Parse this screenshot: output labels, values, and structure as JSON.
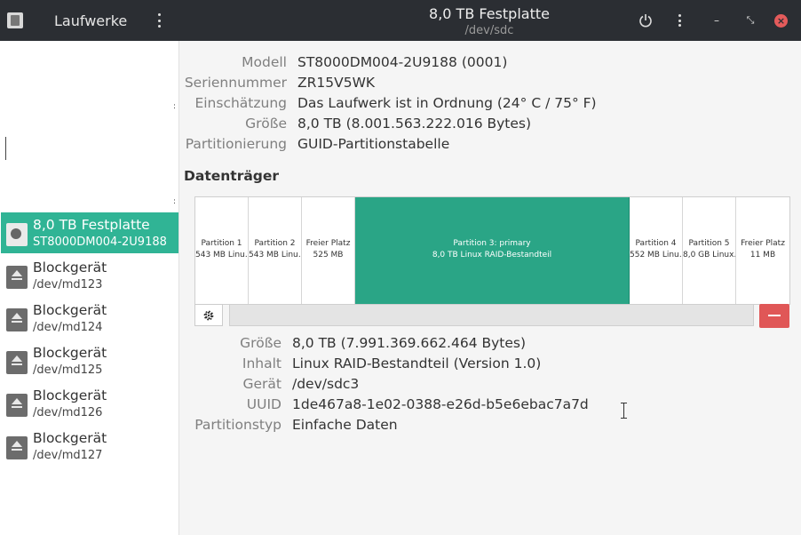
{
  "header": {
    "left_title": "Laufwerke",
    "title": "8,0 TB Festplatte",
    "subtitle": "/dev/sdc",
    "minimize_glyph": "–",
    "restore_glyph": "⤡",
    "close_glyph": "×",
    "icons": [
      "disks-app-icon",
      "menu-dots-icon",
      "power-icon",
      "menu-dots-icon",
      "minimize-icon",
      "restore-icon",
      "close-icon"
    ]
  },
  "sidebar": {
    "items": [
      {
        "title": "8,0 TB Festplatte",
        "subtitle": "ST8000DM004-2U9188",
        "selected": true
      },
      {
        "title": "Blockgerät",
        "subtitle": "/dev/md123"
      },
      {
        "title": "Blockgerät",
        "subtitle": "/dev/md124"
      },
      {
        "title": "Blockgerät",
        "subtitle": "/dev/md125"
      },
      {
        "title": "Blockgerät",
        "subtitle": "/dev/md126"
      },
      {
        "title": "Blockgerät",
        "subtitle": "/dev/md127"
      }
    ]
  },
  "drive": {
    "model_label": "Modell",
    "model": "ST8000DM004-2U9188 (0001)",
    "serial_label": "Seriennummer",
    "serial": "ZR15V5WK",
    "assessment_label": "Einschätzung",
    "assessment": "Das Laufwerk ist in Ordnung (24° C / 75° F)",
    "size_label": "Größe",
    "size": "8,0 TB (8.001.563.222.016 Bytes)",
    "partitioning_label": "Partitionierung",
    "partitioning": "GUID-Partitionstabelle"
  },
  "volumes": {
    "section_title": "Datenträger",
    "segments": [
      {
        "l1": "Partition 1",
        "l2": "543 MB Linu…"
      },
      {
        "l1": "Partition 2",
        "l2": "543 MB Linu…"
      },
      {
        "l1": "Freier Platz",
        "l2": "525 MB"
      },
      {
        "l1": "Partition 3: primary",
        "l2": "8,0 TB Linux RAID-Bestandteil",
        "selected": true
      },
      {
        "l1": "Partition 4",
        "l2": "552 MB Linu…"
      },
      {
        "l1": "Partition 5",
        "l2": "8,0 GB Linux…"
      },
      {
        "l1": "Freier Platz",
        "l2": "11 MB"
      }
    ],
    "accent_color": "#2aa586"
  },
  "partition": {
    "size_label": "Größe",
    "size": "8,0 TB (7.991.369.662.464 Bytes)",
    "content_label": "Inhalt",
    "content": "Linux RAID-Bestandteil (Version 1.0)",
    "device_label": "Gerät",
    "device": "/dev/sdc3",
    "uuid_label": "UUID",
    "uuid": "1de467a8-1e02-0388-e26d-b5e6ebac7a7d",
    "type_label": "Partitionstyp",
    "type": "Einfache Daten"
  },
  "colors": {
    "selection": "#30b495",
    "close": "#e45b5b",
    "remove": "#e05757",
    "headerbar": "#2b2e33"
  }
}
